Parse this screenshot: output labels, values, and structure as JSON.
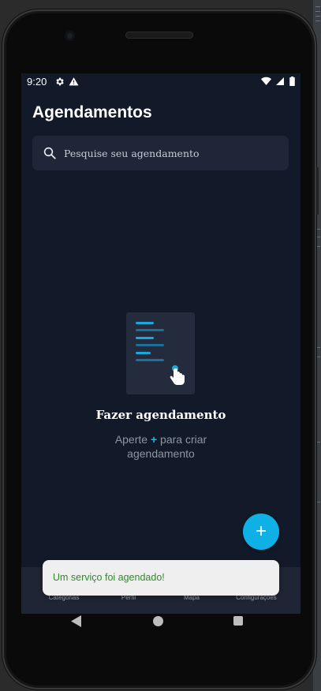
{
  "status_bar": {
    "time": "9:20",
    "icons": [
      "gear-icon",
      "alert-icon",
      "wifi-icon",
      "signal-icon",
      "battery-icon"
    ]
  },
  "header": {
    "title": "Agendamentos"
  },
  "search": {
    "placeholder": "Pesquise seu agendamento",
    "icon": "search-icon"
  },
  "empty_state": {
    "title": "Fazer agendamento",
    "hint_before": "Aperte",
    "hint_plus": "+",
    "hint_after": "para criar",
    "hint_line2": "agendamento",
    "illustration": "document-tap-icon"
  },
  "fab": {
    "label": "+",
    "icon": "plus-icon"
  },
  "bottom_nav": {
    "items": [
      {
        "label": "Categorias"
      },
      {
        "label": "Perfil"
      },
      {
        "label": "Mapa"
      },
      {
        "label": "Configurações"
      }
    ]
  },
  "snackbar": {
    "message": "Um serviço foi agendado!"
  },
  "colors": {
    "background": "#121a2a",
    "surface": "#1e2637",
    "accent": "#0fb0e6",
    "snackbar_text": "#2e8b2a"
  }
}
